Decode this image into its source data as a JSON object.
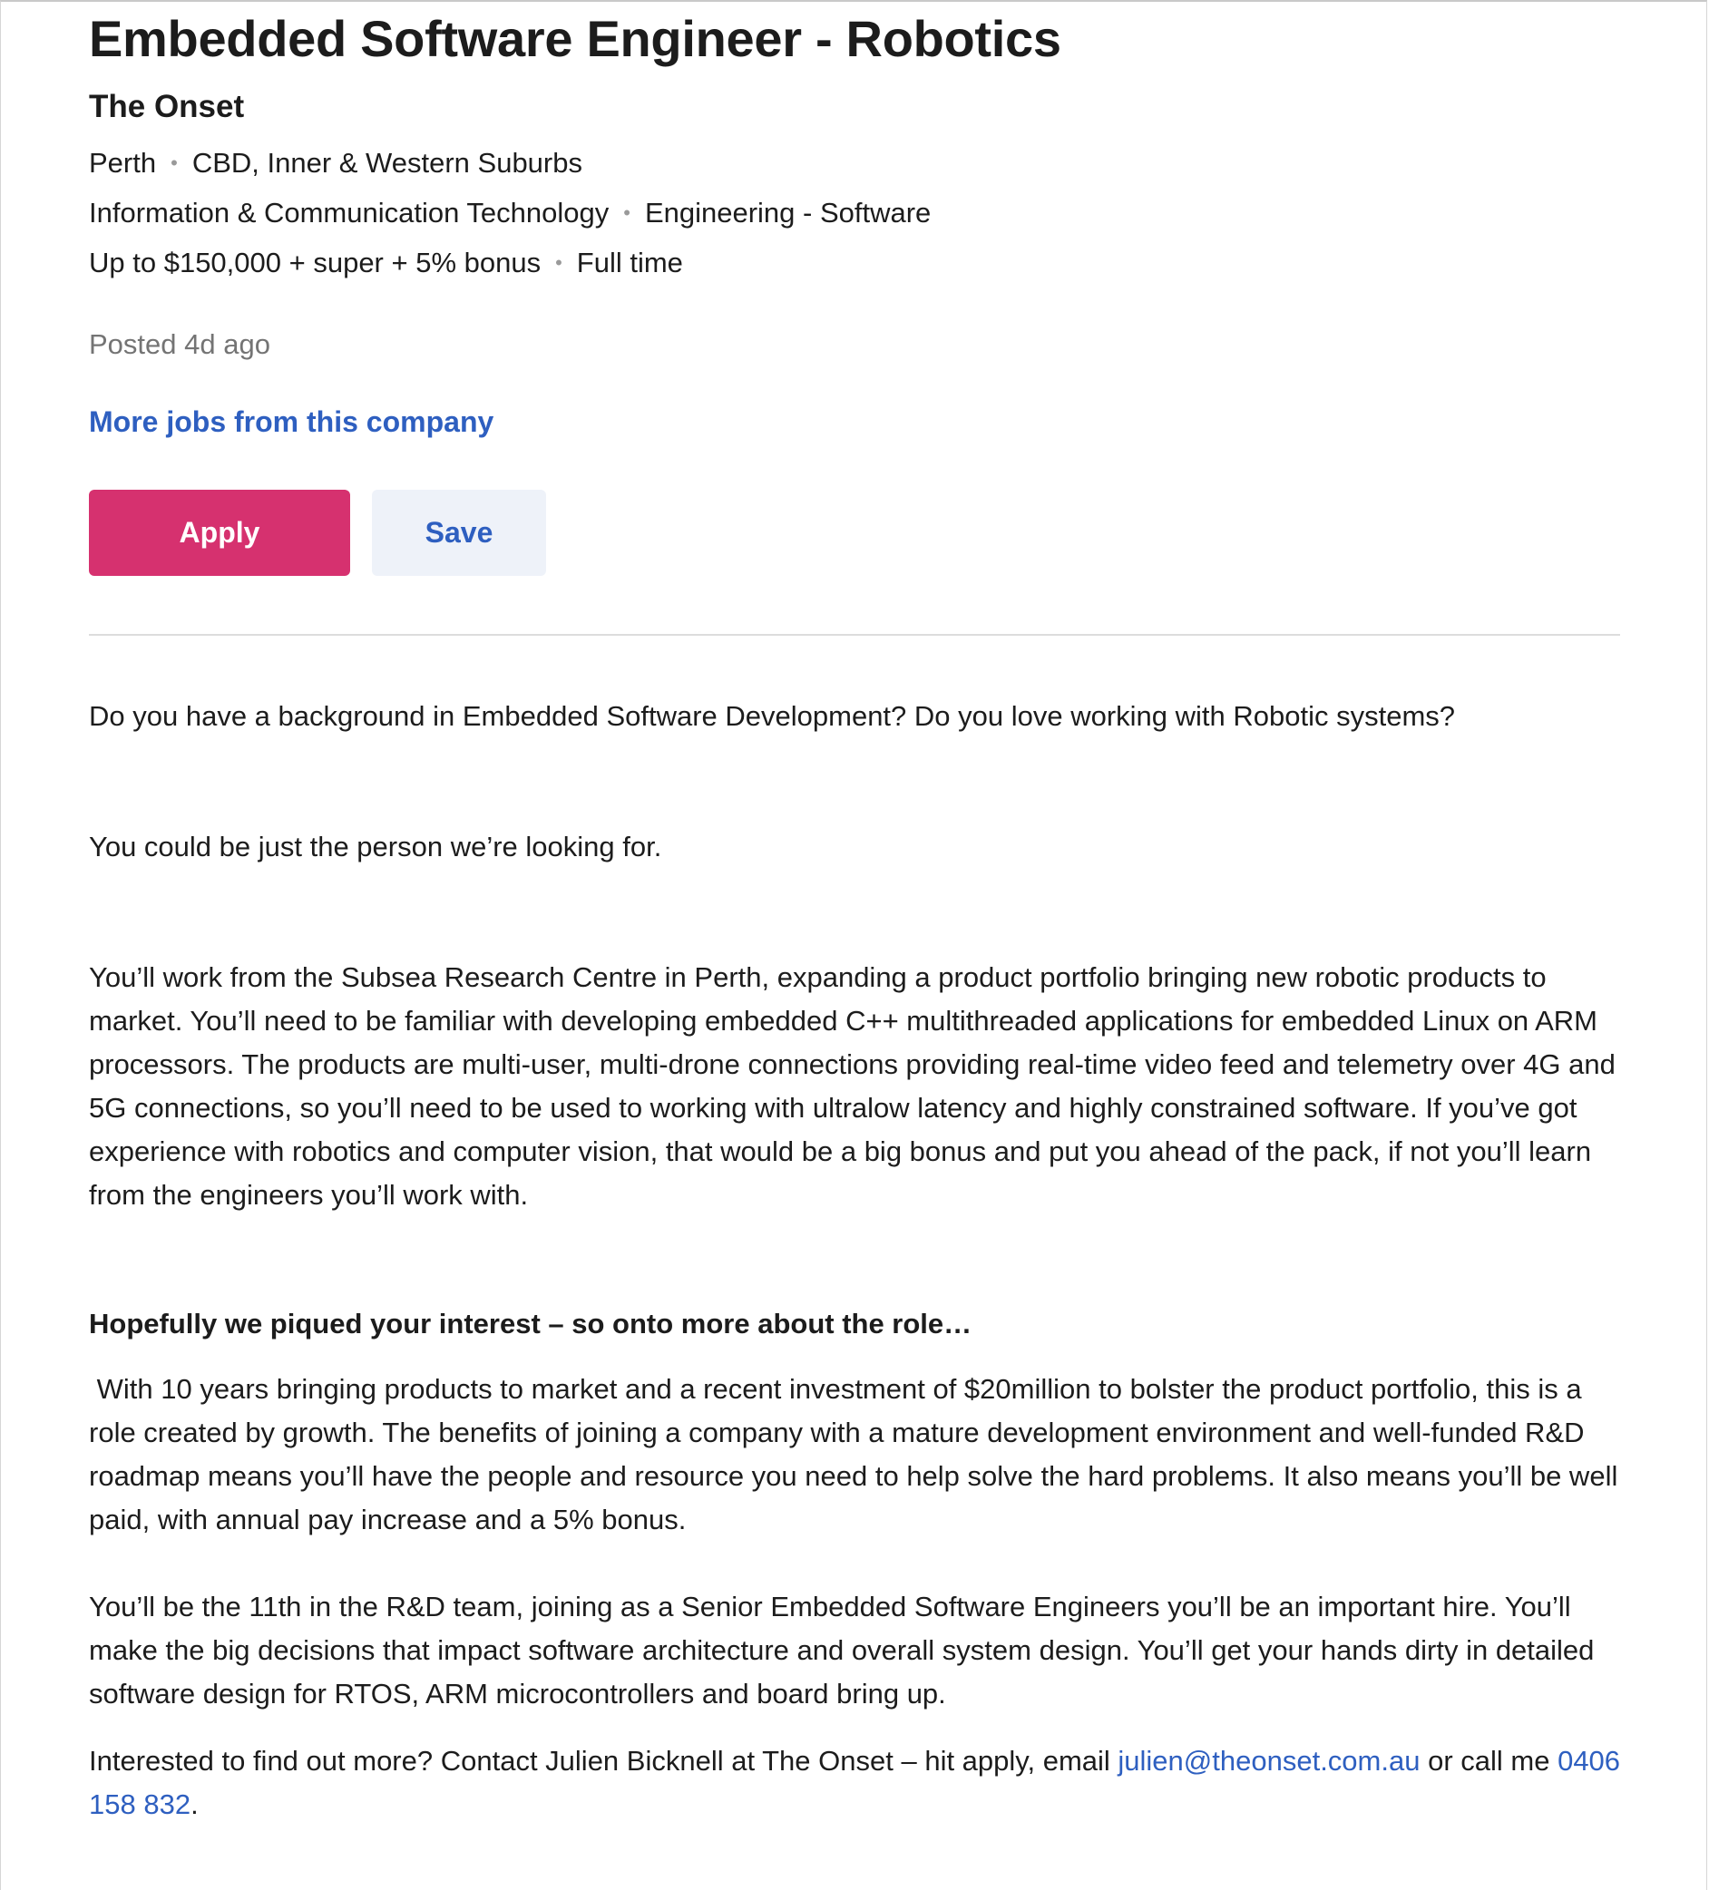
{
  "job": {
    "title": "Embedded Software Engineer - Robotics",
    "company": "The Onset",
    "location": "Perth",
    "area": "CBD, Inner & Western Suburbs",
    "classification": "Information & Communication Technology",
    "subclassification": "Engineering - Software",
    "salary": "Up to $150,000 + super + 5% bonus",
    "work_type": "Full time",
    "posted": "Posted 4d ago",
    "more_jobs_link": "More jobs from this company"
  },
  "actions": {
    "apply_label": "Apply",
    "save_label": "Save"
  },
  "separator_glyph": "•",
  "description": {
    "p1": "Do you have a background in Embedded Software Development? Do you love working with Robotic systems?",
    "p2": "You could be just the person we’re looking for.",
    "p3": "You’ll work from the Subsea Research Centre in Perth, expanding a product portfolio bringing new robotic products to market. You’ll need to be familiar with developing embedded C++ multithreaded applications for embedded Linux on ARM processors. The products are multi-user, multi-drone connections providing real-time video feed and telemetry over 4G and 5G connections, so you’ll need to be used to working with ultralow latency and highly constrained software. If you’ve got experience with robotics and computer vision, that would be a big bonus and put you ahead of the pack, if not you’ll learn from the engineers you’ll work with.",
    "heading": "Hopefully we piqued your interest – so onto more about the role…",
    "p4": " With 10 years bringing products to market and a recent investment of $20million to bolster the product portfolio, this is a role created by growth. The benefits of joining a company with a mature development environment and well-funded R&D roadmap means you’ll have the people and resource you need to help solve the hard problems. It also means you’ll be well paid, with annual pay increase and a 5% bonus.",
    "p5": "You’ll be the 11th in the R&D team, joining as a Senior Embedded Software Engineers you’ll be an important hire. You’ll make the big decisions that impact software architecture and overall system design. You’ll get your hands dirty in detailed software design for RTOS, ARM microcontrollers and board bring up.",
    "contact_prefix": "Interested to find out more? Contact Julien Bicknell at The Onset – hit apply, email ",
    "contact_email": "julien@theonset.com.au",
    "contact_middle": " or call me ",
    "contact_phone": "0406 158 832",
    "contact_suffix": "."
  },
  "colors": {
    "apply_button": "#d6316f",
    "save_button_bg": "#eef2f9",
    "link": "#2e5fc0",
    "muted_text": "#747474"
  }
}
